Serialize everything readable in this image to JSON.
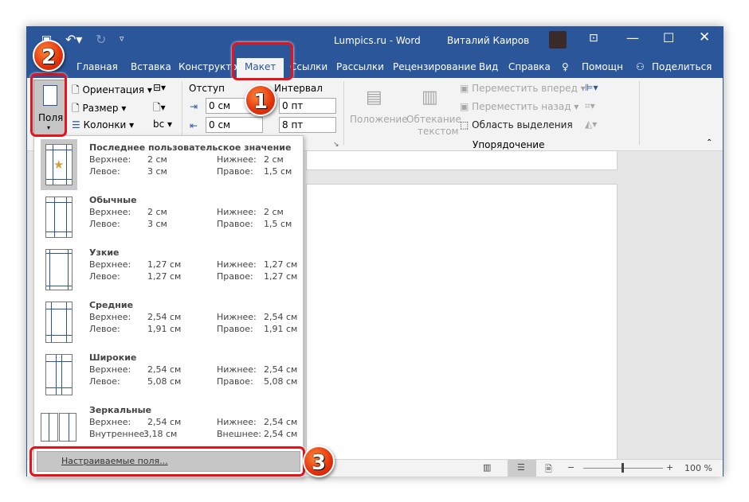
{
  "title_bar": {
    "doc_title": "Lumpics.ru  -  Word",
    "user": "Виталий Каиров"
  },
  "tabs": [
    "Главная",
    "Вставка",
    "Конструкто",
    "Макет",
    "Ссылки",
    "Рассылки",
    "Рецензирование",
    "Вид",
    "Справка"
  ],
  "tell_me": "Помощн",
  "share": "Поделиться",
  "ribbon": {
    "fields": "Поля",
    "orientation": "Ориентация",
    "size": "Размер",
    "columns": "Колонки",
    "indent_label": "Отступ",
    "spacing_label": "Интервал",
    "indent_left": "0 см",
    "indent_right": "0 см",
    "spacing_before": "0 пт",
    "spacing_after": "8 пт",
    "position": "Положение",
    "wrap": "Обтекание",
    "wrap2": "текстом",
    "bring_forward": "Переместить вперед",
    "send_backward": "Переместить назад",
    "selection_pane": "Область выделения",
    "arrange_group": "Упорядочение"
  },
  "margins_menu": {
    "items": [
      {
        "title": "Последнее пользовательское значение",
        "l1": "Верхнее:",
        "v1": "2 см",
        "l2": "Нижнее:",
        "v2": "2 см",
        "l3": "Левое:",
        "v3": "3 см",
        "l4": "Правое:",
        "v4": "1,5 см"
      },
      {
        "title": "Обычные",
        "l1": "Верхнее:",
        "v1": "2 см",
        "l2": "Нижнее:",
        "v2": "2 см",
        "l3": "Левое:",
        "v3": "3 см",
        "l4": "Правое:",
        "v4": "1,5 см"
      },
      {
        "title": "Узкие",
        "l1": "Верхнее:",
        "v1": "1,27 см",
        "l2": "Нижнее:",
        "v2": "1,27 см",
        "l3": "Левое:",
        "v3": "1,27 см",
        "l4": "Правое:",
        "v4": "1,27 см"
      },
      {
        "title": "Средние",
        "l1": "Верхнее:",
        "v1": "2,54 см",
        "l2": "Нижнее:",
        "v2": "2,54 см",
        "l3": "Левое:",
        "v3": "1,91 см",
        "l4": "Правое:",
        "v4": "1,91 см"
      },
      {
        "title": "Широкие",
        "l1": "Верхнее:",
        "v1": "2,54 см",
        "l2": "Нижнее:",
        "v2": "2,54 см",
        "l3": "Левое:",
        "v3": "5,08 см",
        "l4": "Правое:",
        "v4": "5,08 см"
      },
      {
        "title": "Зеркальные",
        "l1": "Верхнее:",
        "v1": "2,54 см",
        "l2": "Нижнее:",
        "v2": "2,54 см",
        "l3": "Внутреннее:",
        "v3": "3,18 см",
        "l4": "Внешнее:",
        "v4": "2,54 см"
      }
    ],
    "custom": "Настраиваемые поля..."
  },
  "status": {
    "zoom": "100 %",
    "zoom_percent": 100
  },
  "badges": [
    "1",
    "2",
    "3"
  ],
  "colors": {
    "accent": "#2b579a",
    "highlight": "#e8121a"
  }
}
